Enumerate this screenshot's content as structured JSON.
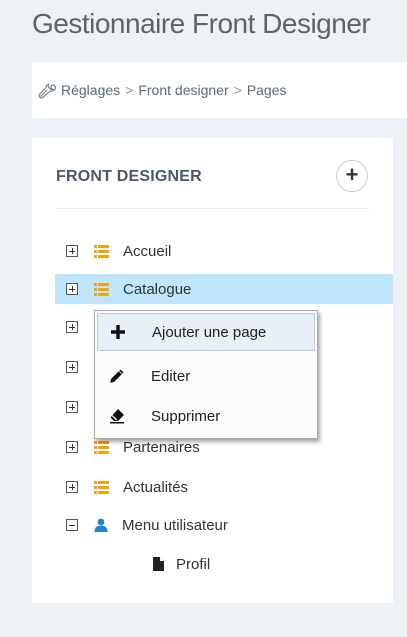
{
  "page": {
    "title": "Gestionnaire Front Designer"
  },
  "breadcrumb": {
    "items": [
      "Réglages",
      "Front designer",
      "Pages"
    ],
    "separator": ">"
  },
  "portlet": {
    "title": "FRONT DESIGNER",
    "add_icon": "plus-circle-icon"
  },
  "tree": {
    "items": [
      {
        "label": "Accueil",
        "icon": "list-icon",
        "expanded": false
      },
      {
        "label": "Catalogue",
        "icon": "list-icon",
        "expanded": false,
        "selected": true
      },
      {
        "label": "",
        "icon": "list-icon",
        "expanded": false
      },
      {
        "label": "",
        "icon": "list-icon",
        "expanded": false
      },
      {
        "label": "",
        "icon": "list-icon",
        "expanded": false
      },
      {
        "label": "Partenaires",
        "icon": "list-icon",
        "expanded": false
      },
      {
        "label": "Actualités",
        "icon": "list-icon",
        "expanded": false
      },
      {
        "label": "Menu utilisateur",
        "icon": "user-icon",
        "expanded": true
      },
      {
        "label": "Profil",
        "icon": "file-icon",
        "child": true
      }
    ]
  },
  "context_menu": {
    "items": [
      {
        "label": "Ajouter une page",
        "icon": "plus-icon"
      },
      {
        "label": "Editer",
        "icon": "pencil-icon"
      },
      {
        "label": "Supprimer",
        "icon": "eraser-icon"
      }
    ]
  },
  "colors": {
    "list_icon": "#f0a30a",
    "user_icon": "#1a88c9",
    "selected_row": "#bfe6fa"
  }
}
